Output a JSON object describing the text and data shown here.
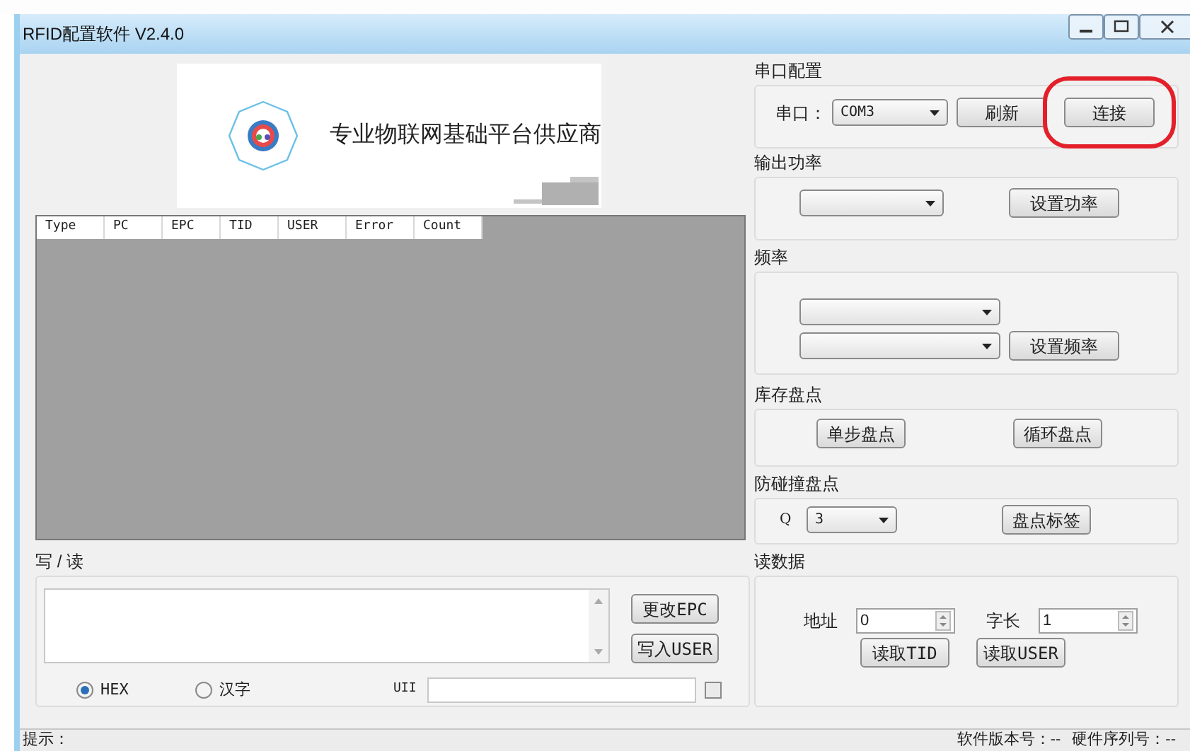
{
  "window": {
    "title": "RFID配置软件 V2.4.0"
  },
  "banner": {
    "slogan": "专业物联网基础平台供应商"
  },
  "table": {
    "columns": [
      "Type",
      "PC",
      "EPC",
      "TID",
      "USER",
      "Error",
      "Count"
    ]
  },
  "write_read": {
    "title": "写 / 读",
    "buttons": [
      "更改EPC",
      "写入USER"
    ],
    "encodings": [
      {
        "label": "HEX",
        "selected": true
      },
      {
        "label": "汉字",
        "selected": false
      }
    ],
    "uii_label": "UII",
    "uii_checked": false
  },
  "serial": {
    "title": "串口配置",
    "port_label": "串口：",
    "port": "COM3",
    "buttons": [
      {
        "label": "刷新",
        "highlighted": false
      },
      {
        "label": "连接",
        "highlighted": true
      }
    ]
  },
  "power": {
    "title": "输出功率",
    "button": "设置功率"
  },
  "frequency": {
    "title": "频率",
    "button": "设置频率"
  },
  "inventory": {
    "title": "库存盘点",
    "buttons": [
      "单步盘点",
      "循环盘点"
    ]
  },
  "anticollision": {
    "title": "防碰撞盘点",
    "q_label": "Q",
    "q_value": "3",
    "button": "盘点标签"
  },
  "read_data": {
    "title": "读数据",
    "address_label": "地址",
    "address": "0",
    "length_label": "字长",
    "length": "1",
    "buttons": [
      "读取TID",
      "读取USER"
    ]
  },
  "status_bar": {
    "hint": "提示：",
    "version": "软件版本号：--",
    "serial": "硬件序列号：--"
  }
}
